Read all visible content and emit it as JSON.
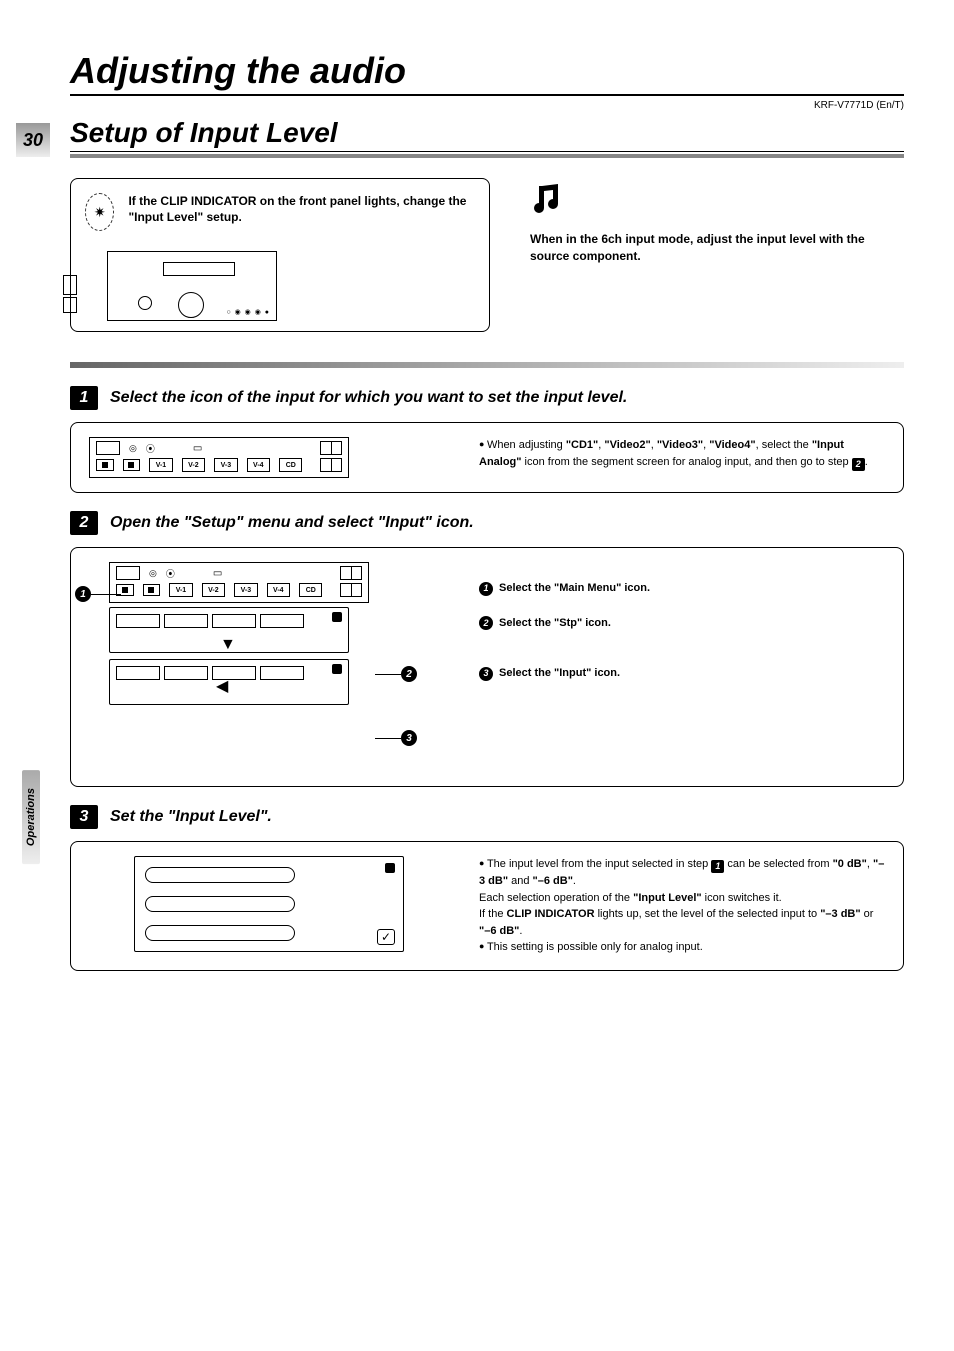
{
  "model_code": "KRF-V7771D (En/T)",
  "page_number": "30",
  "heading1": "Adjusting the audio",
  "heading2": "Setup of Input Level",
  "side_tab": "Operations",
  "intro": {
    "left_text": "If the CLIP INDICATOR on the front panel lights, change the \"Input Level\" setup.",
    "right_text": "When in the 6ch input mode, adjust the input level with the source component."
  },
  "steps": [
    {
      "num": "1",
      "title": "Select the icon of the input for which you want to set the input level.",
      "right_pre": "When adjusting ",
      "right_bold1": "\"CD1\"",
      "right_mid1": ", ",
      "right_bold2": "\"Video2\"",
      "right_mid2": ", ",
      "right_bold3": "\"Video3\"",
      "right_mid3": ", ",
      "right_bold4": "\"Video4\"",
      "right_mid4": ", select the ",
      "right_bold5": "\"Input Analog\"",
      "right_post": " icon from the segment screen for analog input, and then go to step ",
      "right_stepref": "2",
      "right_end": "."
    },
    {
      "num": "2",
      "title": "Open the \"Setup\" menu and select \"Input\" icon.",
      "sub1": "Select the \"Main Menu\" icon.",
      "sub2": "Select the \"Stp\" icon.",
      "sub3": "Select the \"Input\" icon."
    },
    {
      "num": "3",
      "title": "Set the \"Input Level\".",
      "b1_pre": "The input level from the input selected in step ",
      "b1_ref": "1",
      "b1_mid": " can be selected from ",
      "b1_v1": "\"0 dB\"",
      "b1_c1": ", ",
      "b1_v2": "\"–3 dB\"",
      "b1_c2": " and ",
      "b1_v3": "\"–6 dB\"",
      "b1_end": ".",
      "b2_pre": "Each selection operation of the ",
      "b2_bold": "\"Input Level\"",
      "b2_post": " icon switches it.",
      "b3_pre": "If the ",
      "b3_bold": "CLIP INDICATOR",
      "b3_mid": " lights up, set the level of the selected input to ",
      "b3_v1": "\"–3 dB\"",
      "b3_or": " or ",
      "b3_v2": "\"–6 dB\"",
      "b3_end": ".",
      "b4": "This setting is possible only for analog input."
    }
  ]
}
